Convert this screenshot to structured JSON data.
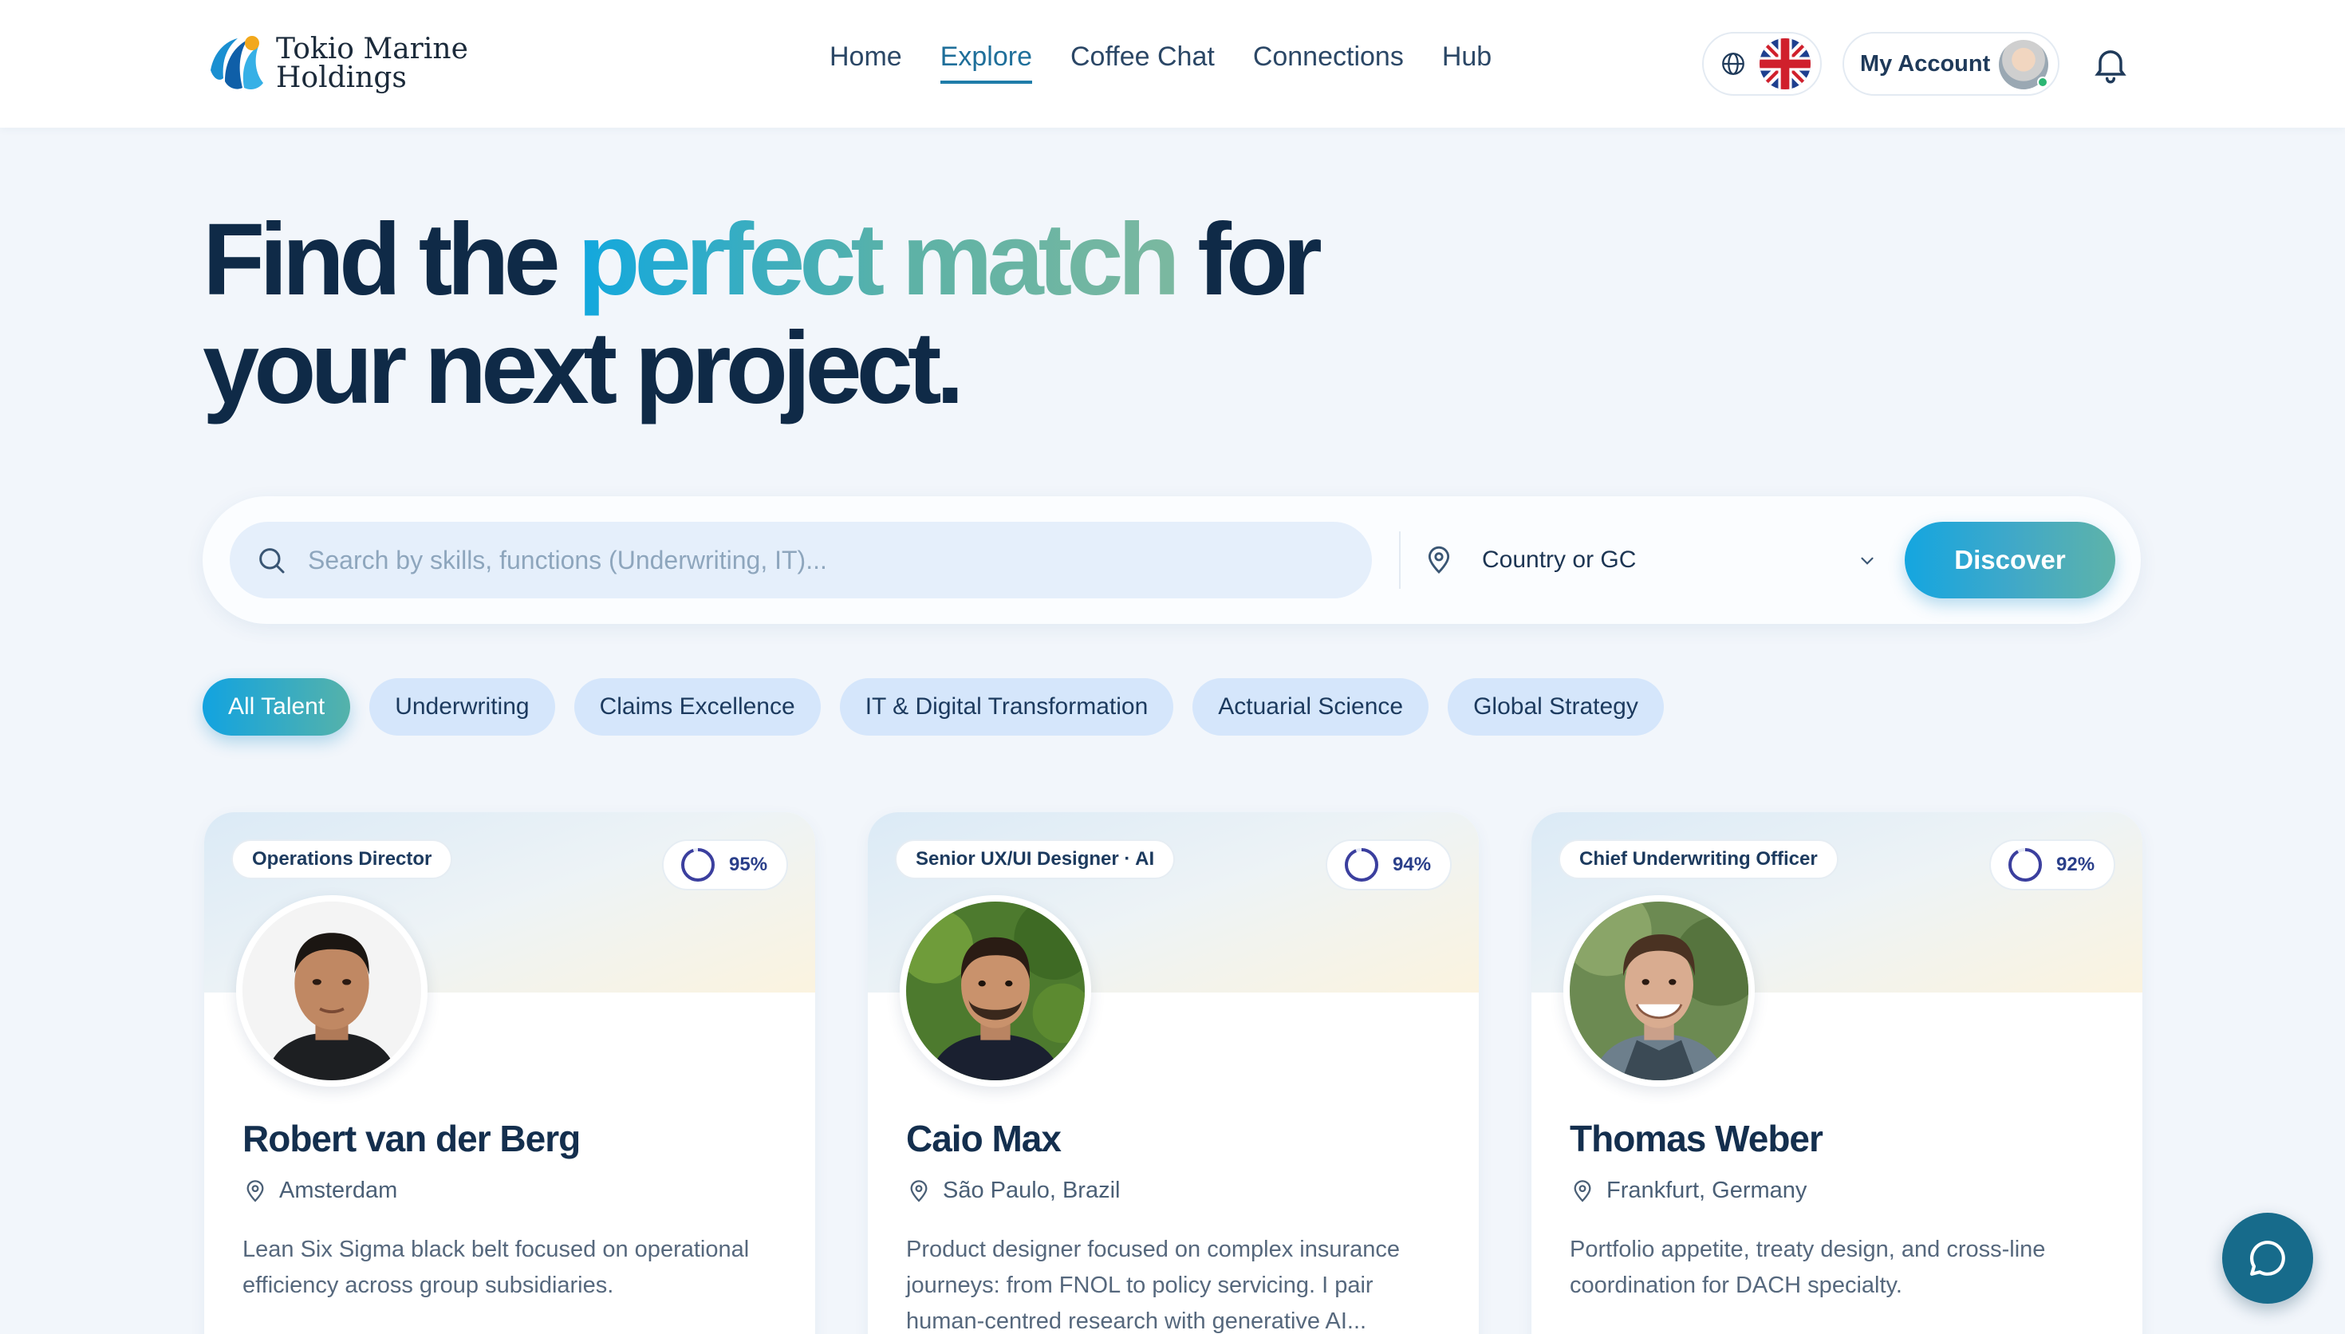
{
  "brand": {
    "line1": "Tokio Marine",
    "line2": "Holdings"
  },
  "nav": [
    "Home",
    "Explore",
    "Coffee Chat",
    "Connections",
    "Hub"
  ],
  "nav_active": "Explore",
  "header": {
    "account_label": "My Account",
    "language_icon": "globe-icon",
    "flag": "uk-flag",
    "notifications_icon": "bell-icon"
  },
  "hero": {
    "line1_a": "Find the ",
    "line1_highlight": "perfect match",
    "line1_b": " for",
    "line2": "your next project."
  },
  "search": {
    "placeholder": "Search by skills, functions (Underwriting, IT)...",
    "value": "",
    "location_label": "Country or GC",
    "button_label": "Discover"
  },
  "filters": [
    "All Talent",
    "Underwriting",
    "Claims Excellence",
    "IT & Digital Transformation",
    "Actuarial Science",
    "Global Strategy"
  ],
  "filters_active": "All Talent",
  "cards": [
    {
      "role": "Operations Director",
      "score_label": "95%",
      "score": 0.95,
      "name": "Robert van der Berg",
      "location": "Amsterdam",
      "bio": "Lean Six Sigma black belt focused on operational efficiency across group subsidiaries."
    },
    {
      "role": "Senior UX/UI Designer · AI",
      "score_label": "94%",
      "score": 0.94,
      "name": "Caio Max",
      "location": "São Paulo, Brazil",
      "bio": "Product designer focused on complex insurance journeys: from FNOL to policy servicing. I pair human-centred research with generative AI..."
    },
    {
      "role": "Chief Underwriting Officer",
      "score_label": "92%",
      "score": 0.92,
      "name": "Thomas Weber",
      "location": "Frankfurt, Germany",
      "bio": "Portfolio appetite, treaty design, and cross-line coordination for DACH specialty."
    }
  ],
  "colors": {
    "brand_navy": "#0f2a47",
    "accent_blue": "#12a8de",
    "accent_teal": "#5db2a6",
    "chip_bg": "#d5e6fb",
    "chat_button": "#176b8b"
  }
}
